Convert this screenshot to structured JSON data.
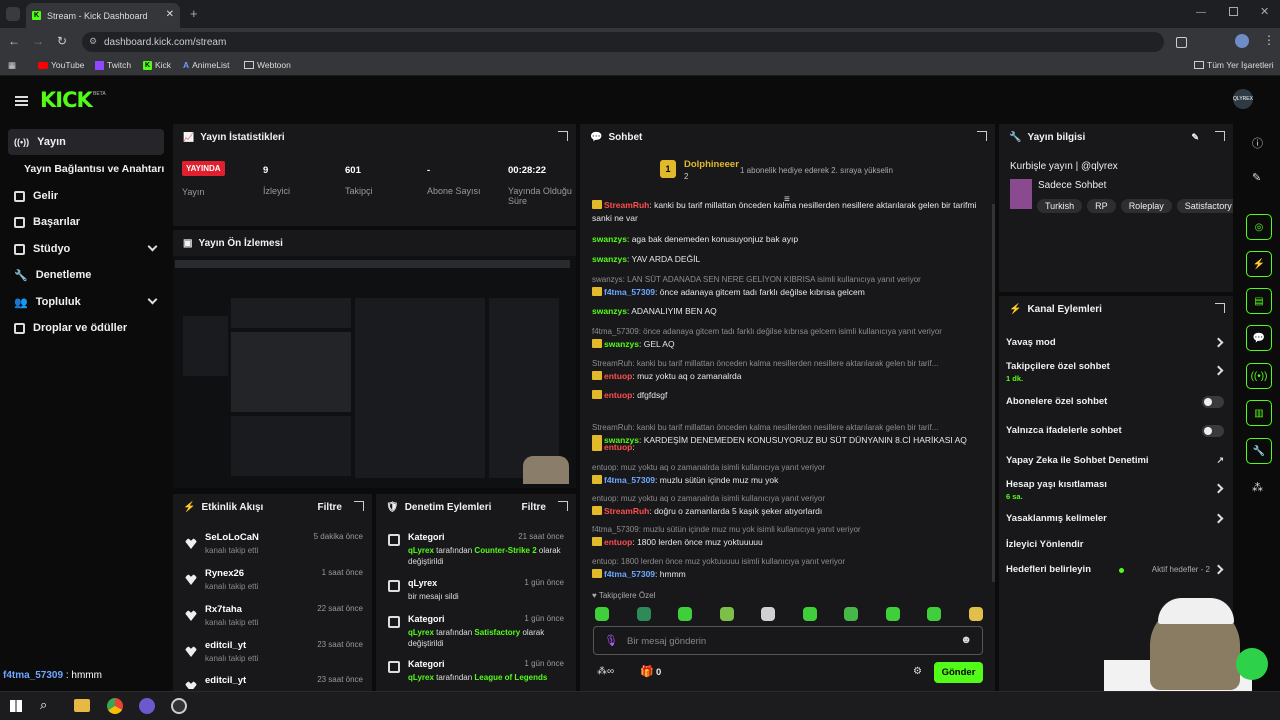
{
  "browser": {
    "tab_title": "Stream - Kick Dashboard",
    "url": "dashboard.kick.com/stream",
    "bookmarks": [
      "YouTube",
      "Twitch",
      "Kick",
      "AnimeList",
      "Webtoon"
    ],
    "all_bookmarks": "Tüm Yer İşaretleri"
  },
  "header": {
    "logo": "KICK",
    "logo_beta": "BETA",
    "avatar_label": "QLYREX"
  },
  "sidebar": {
    "items": [
      {
        "label": "Yayın"
      },
      {
        "label": "Yayın Bağlantısı ve Anahtarı"
      },
      {
        "label": "Gelir"
      },
      {
        "label": "Başarılar"
      },
      {
        "label": "Stüdyo"
      },
      {
        "label": "Denetleme"
      },
      {
        "label": "Topluluk"
      },
      {
        "label": "Droplar ve ödüller"
      }
    ]
  },
  "stats": {
    "title": "Yayın İstatistikleri",
    "live": "YAYINDA",
    "live_label": "Yayın",
    "viewers": "9",
    "viewers_label": "İzleyici",
    "followers": "601",
    "followers_label": "Takipçi",
    "subs": "-",
    "subs_label": "Abone Sayısı",
    "uptime": "00:28:22",
    "uptime_label": "Yayında Olduğu Süre"
  },
  "preview": {
    "title": "Yayın Ön İzlemesi"
  },
  "activity": {
    "title": "Etkinlik Akışı",
    "filter": "Filtre",
    "items": [
      {
        "name": "SeLoLoCaN",
        "sub": "kanalı takip etti",
        "time": "5 dakika önce"
      },
      {
        "name": "Rynex26",
        "sub": "kanalı takip etti",
        "time": "1 saat önce"
      },
      {
        "name": "Rx7taha",
        "sub": "kanalı takip etti",
        "time": "22 saat önce"
      },
      {
        "name": "editcil_yt",
        "sub": "kanalı takip etti",
        "time": "23 saat önce"
      },
      {
        "name": "editcil_yt",
        "sub": "",
        "time": "23 saat önce"
      }
    ]
  },
  "moderation": {
    "title": "Denetim Eylemleri",
    "filter": "Filtre",
    "items": [
      {
        "name": "Kategori",
        "user": "qLyrex",
        "mid": " tarafından ",
        "target": "Counter-Strike 2",
        "end": " olarak değiştirildi",
        "time": "21 saat önce"
      },
      {
        "name": "qLyrex",
        "user": "",
        "mid": "bir mesajı sildi",
        "target": "",
        "end": "",
        "time": "1 gün önce"
      },
      {
        "name": "Kategori",
        "user": "qLyrex",
        "mid": " tarafından ",
        "target": "Satisfactory",
        "end": " olarak değiştirildi",
        "time": "1 gün önce"
      },
      {
        "name": "Kategori",
        "user": "qLyrex",
        "mid": " tarafından ",
        "target": "League of Legends",
        "end": "",
        "time": "1 gün önce"
      }
    ]
  },
  "chat": {
    "title": "Sohbet",
    "pinned_user": "Dolphineeer",
    "pinned_rank": "1",
    "pinned_count": "2",
    "pinned_text": "1 abonelik hediye ederek 2. sıraya yükselin",
    "messages": [
      {
        "reply": "",
        "user": "StreamRuh",
        "cls": "u-red",
        "text": "kanki bu tarif millattan önceden kalma nesillerden nesillere aktarılarak gelen bir tarifmi sanki ne var"
      },
      {
        "reply": "",
        "user": "swanzys",
        "cls": "u-green",
        "text": "aga bak denemeden konusuyonjuz bak ayıp"
      },
      {
        "reply": "",
        "user": "swanzys",
        "cls": "u-green",
        "text": "YAV ARDA DEĞİL"
      },
      {
        "reply": "swanzys: LAN SÜT ADANADA SEN NERE GELİYON KIBRISA isimli kullanıcıya yanıt veriyor",
        "user": "f4tma_57309",
        "cls": "u-blue",
        "text": "önce adanaya gitcem tadı farklı değilse kıbrısa gelcem"
      },
      {
        "reply": "",
        "user": "swanzys",
        "cls": "u-green",
        "text": "ADANALIYIM BEN AQ"
      },
      {
        "reply": "f4tma_57309: önce adanaya gitcem tadı farklı değilse kıbrısa gelcem isimli kullanıcıya yanıt veriyor",
        "user": "swanzys",
        "cls": "u-green",
        "text": "GEL AQ"
      },
      {
        "reply": "StreamRuh: kanki bu tarif millattan önceden kalma nesillerden nesillere aktarılarak gelen bir tarif...",
        "user": "entuop",
        "cls": "u-red",
        "text": "muz yoktu aq o zamanalrda"
      },
      {
        "reply": "",
        "user": "entuop",
        "cls": "u-red",
        "text": "dfgfdsgf"
      },
      {
        "reply": "StreamRuh: kanki bu tarif millattan önceden kalma nesillerden nesillere aktarılarak gelen bir tarif...",
        "user": "swanzys",
        "cls": "u-green",
        "text": "KARDEŞİM DENEMEDEN KONUSUYORUZ BU SÜT DÜNYANIN 8.Cİ HARİKASI AQ"
      },
      {
        "reply": "",
        "user": "entuop",
        "cls": "u-red",
        "text": ""
      },
      {
        "reply": "entuop: muz yoktu aq o zamanalrda isimli kullanıcıya yanıt veriyor",
        "user": "f4tma_57309",
        "cls": "u-blue",
        "text": "muzlu sütün içinde muz mu yok"
      },
      {
        "reply": "entuop: muz yoktu aq o zamanalrda isimli kullanıcıya yanıt veriyor",
        "user": "StreamRuh",
        "cls": "u-red",
        "text": "doğru o zamanlarda 5 kaşık şeker atıyorlardı"
      },
      {
        "reply": "f4tma_57309: muzlu sütün içinde muz mu yok isimli kullanıcıya yanıt veriyor",
        "user": "entuop",
        "cls": "u-red",
        "text": "1800 lerden önce muz yoktuuuuu"
      },
      {
        "reply": "entuop: 1800 lerden önce muz yoktuuuuu isimli kullanıcıya yanıt veriyor",
        "user": "f4tma_57309",
        "cls": "u-blue",
        "text": "hmmm"
      }
    ],
    "followers_only": "Takipçilere Özel",
    "placeholder": "Bir mesaj gönderin",
    "send": "Gönder",
    "gift_count": "0"
  },
  "info": {
    "title": "Yayın bilgisi",
    "stream_title": "Kurbişle yayın | @qlyrex",
    "category": "Sadece Sohbet",
    "tags": [
      "Turkish",
      "RP",
      "Roleplay",
      "Satisfactory"
    ]
  },
  "channel": {
    "title": "Kanal Eylemleri",
    "items": [
      {
        "label": "Yavaş mod",
        "sub": "",
        "kind": "arrow"
      },
      {
        "label": "Takipçilere özel sohbet",
        "sub": "1 dk.",
        "kind": "arrow"
      },
      {
        "label": "Abonelere özel sohbet",
        "sub": "",
        "kind": "toggle"
      },
      {
        "label": "Yalnızca ifadelerle sohbet",
        "sub": "",
        "kind": "toggle"
      },
      {
        "label": "Yapay Zeka ile Sohbet Denetimi",
        "sub": "",
        "kind": "ext"
      },
      {
        "label": "Hesap yaşı kısıtlaması",
        "sub": "6 sa.",
        "kind": "arrow"
      },
      {
        "label": "Yasaklanmış kelimeler",
        "sub": "",
        "kind": "arrow"
      },
      {
        "label": "İzleyici Yönlendir",
        "sub": "",
        "kind": "none"
      },
      {
        "label": "Hedefleri belirleyin",
        "sub": "",
        "kind": "arrow"
      }
    ],
    "goals_status": "Aktif hedefler - 2"
  },
  "overlay": {
    "chat_line_user": "f4tma_57309",
    "chat_line_text": "hmmm"
  },
  "colors": {
    "accent": "#53fc18",
    "panel": "#18181b",
    "background": "#0b0b0c"
  }
}
